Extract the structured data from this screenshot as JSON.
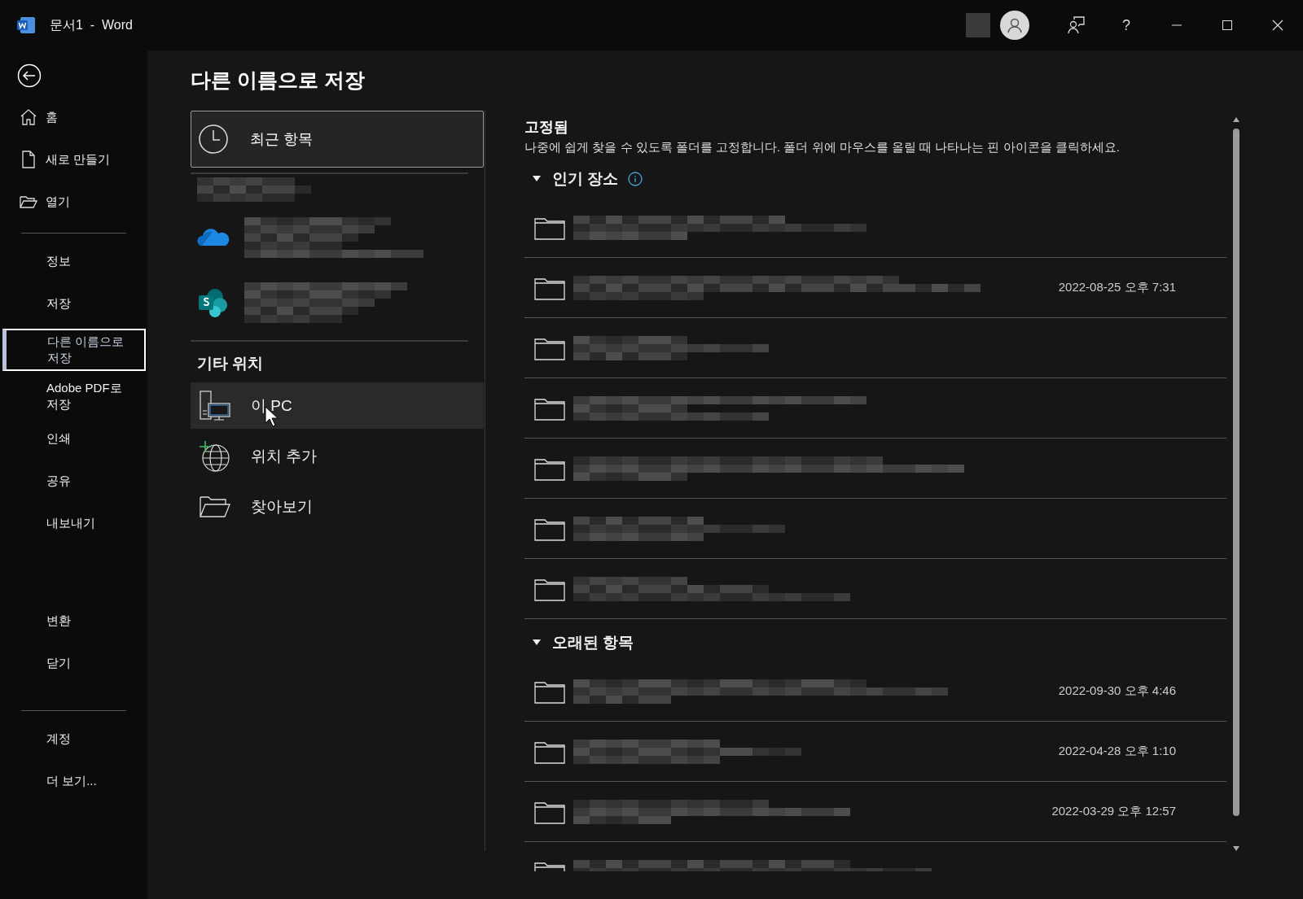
{
  "window": {
    "title": "문서1  -  Word",
    "help": "?"
  },
  "sidebar": {
    "primary": [
      {
        "kind": "home",
        "label": "홈",
        "selected": false
      },
      {
        "kind": "document",
        "label": "새로 만들기",
        "selected": false
      },
      {
        "kind": "folder",
        "label": "열기",
        "selected": false
      }
    ],
    "secondary": [
      {
        "label": "정보",
        "selected": false
      },
      {
        "label": "저장",
        "selected": false
      },
      {
        "label": "다른 이름으로 저장",
        "selected": true
      },
      {
        "label": "Adobe PDF로 저장",
        "selected": false
      },
      {
        "label": "인쇄",
        "selected": false
      },
      {
        "label": "공유",
        "selected": false
      },
      {
        "label": "내보내기",
        "selected": false
      }
    ],
    "tertiary": [
      {
        "label": "변환",
        "selected": false
      },
      {
        "label": "닫기",
        "selected": false
      }
    ],
    "footer": [
      {
        "label": "계정",
        "selected": false
      },
      {
        "label": "더 보기...",
        "selected": false
      }
    ]
  },
  "page_title": "다른 이름으로 저장",
  "locations": {
    "recent": {
      "label": "최근 항목",
      "selected": true
    },
    "accounts": [
      {
        "kind": "plain"
      },
      {
        "kind": "onedrive"
      },
      {
        "kind": "sharepoint"
      }
    ],
    "other_heading": "기타 위치",
    "other": [
      {
        "kind": "pc",
        "label": "이 PC",
        "hovered": true
      },
      {
        "kind": "globe",
        "label": "위치 추가",
        "hovered": false
      },
      {
        "kind": "folder",
        "label": "찾아보기",
        "hovered": false
      }
    ]
  },
  "pinned": {
    "title": "고정됨",
    "description": "나중에 쉽게 찾을 수 있도록 폴더를 고정합니다. 폴더 위에 마우스를 올릴 때 나타나는 핀 아이콘을 클릭하세요.",
    "groups": [
      {
        "label": "인기 장소",
        "expanded": true,
        "info": true,
        "folders": [
          {
            "kind": "redacted"
          },
          {
            "kind": "redacted",
            "date": "2022-08-25 오후 7:31"
          },
          {
            "kind": "redacted"
          },
          {
            "kind": "redacted"
          },
          {
            "kind": "redacted"
          },
          {
            "kind": "redacted"
          },
          {
            "kind": "redacted"
          }
        ]
      },
      {
        "label": "오래된 항목",
        "expanded": true,
        "info": false,
        "folders": [
          {
            "kind": "redacted",
            "date": "2022-09-30 오후 4:46"
          },
          {
            "kind": "redacted",
            "date": "2022-04-28 오후 1:10"
          },
          {
            "kind": "redacted",
            "date": "2022-03-29 오후 12:57"
          },
          {
            "kind": "redacted"
          }
        ]
      }
    ]
  }
}
